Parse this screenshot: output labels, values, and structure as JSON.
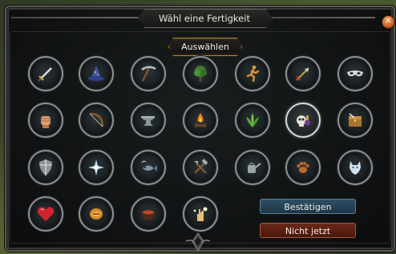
{
  "dialog": {
    "title": "Wähl eine Fertigkeit",
    "select_label": "Auswählen",
    "close_icon": "close-icon",
    "confirm_label": "Bestätigen",
    "decline_label": "Nicht jetzt"
  },
  "colors": {
    "accent_gold": "#b8862f",
    "confirm_blue": "#2e4f66",
    "decline_red": "#6b2818",
    "close_orange": "#d0652a"
  },
  "skills": [
    {
      "icon": "sword-icon"
    },
    {
      "icon": "wizard-hat-icon"
    },
    {
      "icon": "pickaxe-icon"
    },
    {
      "icon": "tree-icon"
    },
    {
      "icon": "running-figure-icon"
    },
    {
      "icon": "arrow-icon"
    },
    {
      "icon": "mask-icon"
    },
    {
      "icon": "fist-icon"
    },
    {
      "icon": "bow-icon"
    },
    {
      "icon": "anvil-icon"
    },
    {
      "icon": "campfire-icon"
    },
    {
      "icon": "herb-leaves-icon"
    },
    {
      "icon": "skull-potion-icon",
      "selected": true
    },
    {
      "icon": "crafting-chest-icon"
    },
    {
      "icon": "shield-icon"
    },
    {
      "icon": "star-sparkle-icon"
    },
    {
      "icon": "fishing-icon"
    },
    {
      "icon": "crossed-tools-icon"
    },
    {
      "icon": "watering-can-icon"
    },
    {
      "icon": "paw-icon"
    },
    {
      "icon": "wolf-icon"
    },
    {
      "icon": "heart-icon"
    },
    {
      "icon": "scroll-icon"
    },
    {
      "icon": "cooking-pot-icon"
    },
    {
      "icon": "magic-hand-icon"
    }
  ]
}
